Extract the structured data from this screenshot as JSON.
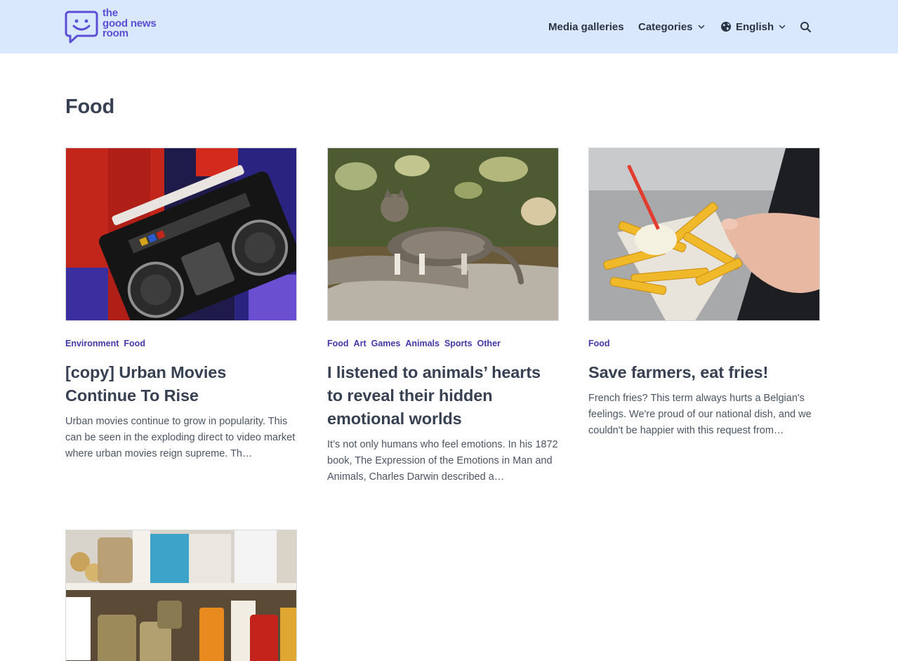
{
  "header": {
    "logo_lines": [
      "the",
      "good news",
      "room"
    ],
    "nav": {
      "media_galleries": "Media galleries",
      "categories": "Categories",
      "language": "English"
    },
    "icons": {
      "globe": "globe-icon",
      "search": "search-icon",
      "chevron": "chevron-down-icon"
    }
  },
  "page": {
    "title": "Food"
  },
  "articles": [
    {
      "tags": [
        "Environment",
        "Food"
      ],
      "title": "[copy] Urban Movies Continue To Rise",
      "excerpt": "Urban movies continue to grow in popularity. This can be seen in the exploding direct to video market where urban movies reign supreme. Th…"
    },
    {
      "tags": [
        "Food",
        "Art",
        "Games",
        "Animals",
        "Sports",
        "Other"
      ],
      "title": "I listened to animals’ hearts to reveal their hidden emotional worlds",
      "excerpt": "It’s not only humans who feel emotions. In his 1872 book, The Expression of the Emotions in Man and Animals, Charles Darwin described a…"
    },
    {
      "tags": [
        "Food"
      ],
      "title": "Save farmers, eat fries!",
      "excerpt": "French fries? This term always hurts a Belgian's feelings. We're proud of our national dish, and we couldn't be happier with this request from…"
    },
    {
      "tags": [],
      "title": "",
      "excerpt": ""
    }
  ],
  "colors": {
    "header_bg": "#d9e8fd",
    "brand": "#5b4fd6",
    "tag": "#4338a8",
    "title": "#374151"
  }
}
